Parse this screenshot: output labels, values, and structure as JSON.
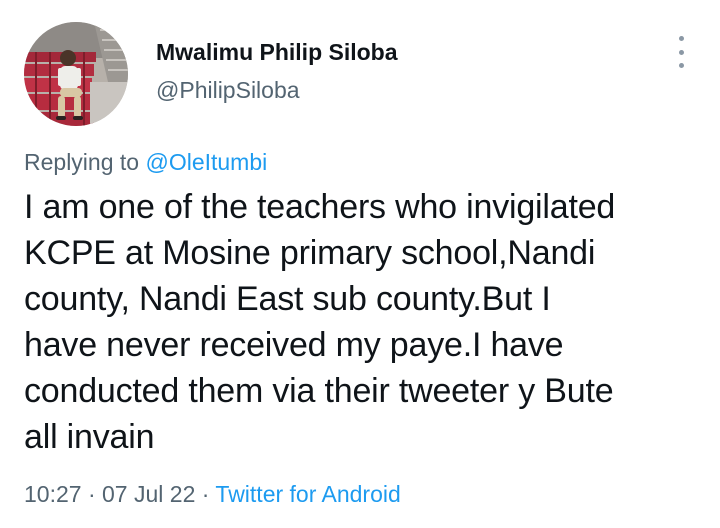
{
  "author": {
    "display_name": "Mwalimu Philip Siloba",
    "handle": "@PhilipSiloba"
  },
  "reply": {
    "prefix": "Replying to",
    "to_handle": "@OleItumbi"
  },
  "tweet": {
    "lines": [
      "I am one of the teachers who invigilated",
      "KCPE at Mosine primary school,Nandi",
      "county, Nandi East sub county.But I",
      "have never received my paye.I have",
      "conducted them via their tweeter y Bute",
      "all invain"
    ]
  },
  "meta": {
    "time": "10:27",
    "separator": "·",
    "date": "07 Jul 22",
    "source": "Twitter for Android"
  },
  "icons": {
    "more": "more-options-icon",
    "avatar": "avatar-photo"
  },
  "colors": {
    "accent": "#1d9bf0",
    "secondary_text": "#536471",
    "primary_text": "#0f1419"
  }
}
